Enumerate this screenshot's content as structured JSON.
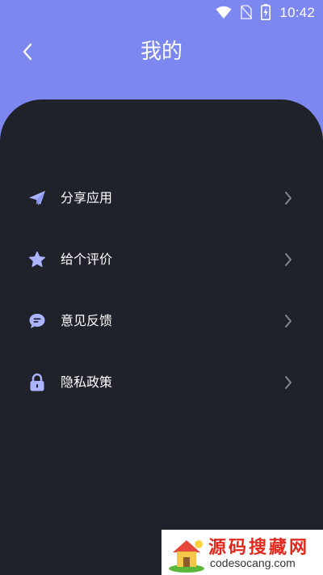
{
  "status_bar": {
    "time": "10:42",
    "icons": [
      "wifi-icon",
      "no-sim-icon",
      "battery-charging-icon"
    ]
  },
  "header": {
    "title": "我的",
    "back_icon": "chevron-left-icon"
  },
  "menu": {
    "items": [
      {
        "label": "分享应用",
        "icon": "paper-plane-icon"
      },
      {
        "label": "给个评价",
        "icon": "star-icon"
      },
      {
        "label": "意见反馈",
        "icon": "chat-bubble-icon"
      },
      {
        "label": "隐私政策",
        "icon": "lock-icon"
      }
    ]
  },
  "watermark": {
    "title": "源码搜藏网",
    "url": "codesocang.com"
  },
  "colors": {
    "header_background": "#7d87f0",
    "panel_background": "#20222b",
    "icon_accent": "#aab4ff",
    "chevron": "#8a8d96",
    "text": "#ffffff",
    "watermark_title": "#e0281e"
  }
}
